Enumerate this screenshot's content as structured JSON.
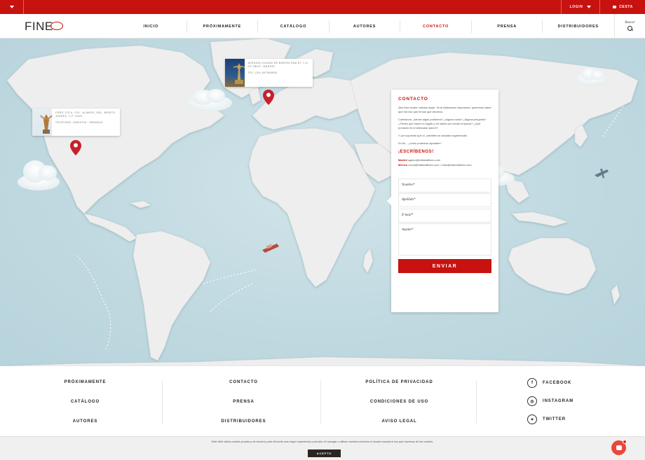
{
  "topbar": {
    "login_label": "LOGIN",
    "cart_label": "CESTA"
  },
  "header": {
    "logo_text": "FINE",
    "nav": [
      {
        "label": "INICIO"
      },
      {
        "label": "PRÓXIMAMENTE"
      },
      {
        "label": "CATÁLOGO"
      },
      {
        "label": "AUTORES"
      },
      {
        "label": "CONTACTO"
      },
      {
        "label": "PRENSA"
      },
      {
        "label": "DISTRIBUIDORES"
      }
    ],
    "active_nav": "CONTACTO",
    "search_label": "Buscar"
  },
  "locations": {
    "madrid": {
      "address": "AVENIDA CIUDAD DE BARCELONA 87, 1 A, CP 28007, MADRID",
      "phone": "TEL: (34) 697966838"
    },
    "mexico": {
      "address": "CERO 175 A, COL. ALAMOS, DEL. BENITO JUÁREZ, C.P. 5400",
      "phone": "TELÉFONO: 55500799 / 55550819"
    }
  },
  "contact": {
    "title": "CONTACTO",
    "intro": "Qué bien recibir noticias tuyas. Ya te estábamos esperando, queremos saber qué era eso que tenías que decirnos.",
    "questions": "Cuéntanos: ¿tienes algún problema? ¿Alguna duda? ¿Alguna pregunta? ¿Tienes que hacer un regalo y no sabes por dónde empezar? ¿Qué producto es el adecuado para ti?",
    "suggestions": "Y por supuesto que sí, ¡también se aceptan sugerencias!",
    "closing": "En fin... ¿cómo podemos ayudarte?",
    "write_title": "¡ESCRÍBENOS!",
    "emails": [
      {
        "city": "Madrid",
        "address": "sgarzo@editorialfineo.com"
      },
      {
        "city": "México",
        "address": "ocom@editorialfineo.com / rodio@editorialfineo.com"
      }
    ],
    "form": {
      "name_placeholder": "Nombre*",
      "surname_placeholder": "Apellido*",
      "email_placeholder": "E-mail*",
      "message_placeholder": "Asunto*",
      "submit_label": "ENVIAR"
    }
  },
  "footer": {
    "col1": [
      "PRÓXIMAMENTE",
      "CATÁLOGO",
      "AUTORES"
    ],
    "col2": [
      "CONTACTO",
      "PRENSA",
      "DISTRIBUIDORES"
    ],
    "col3": [
      "POLÍTICA DE PRIVACIDAD",
      "CONDICIONES DE USO",
      "AVISO LEGAL"
    ],
    "social": [
      {
        "label": "FACEBOOK",
        "icon": "facebook-icon",
        "glyph": "f"
      },
      {
        "label": "INSTAGRAM",
        "icon": "instagram-icon",
        "glyph": "◎"
      },
      {
        "label": "TWITTER",
        "icon": "twitter-icon",
        "glyph": "✦"
      }
    ]
  },
  "cookie": {
    "message": "Este Web utiliza cookies propias y de terceros para ofrecerle una mayor experiencia y servicio. Al navegar o utilizar nuestros servicios el usuario acepta el uso que hacemos de las cookies.",
    "accept_label": "ACEPTO"
  },
  "colors": {
    "brand_red": "#c8120f",
    "map_sea": "#c3dbe2",
    "land": "#efefef"
  }
}
